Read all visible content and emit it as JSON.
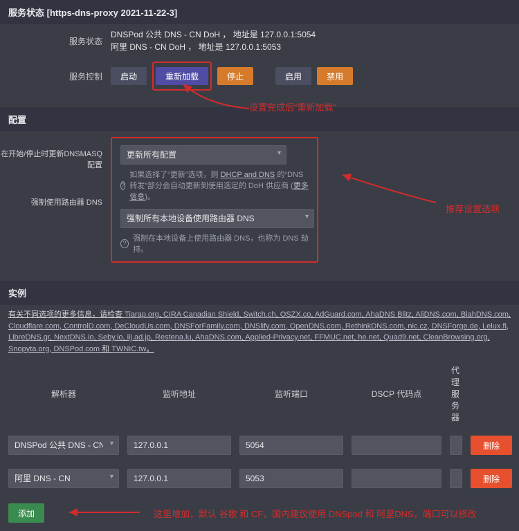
{
  "header": {
    "title": "服务状态 [https-dns-proxy 2021-11-22-3]"
  },
  "status": {
    "label": "服务状态",
    "line1": "DNSPod 公共 DNS - CN DoH ， 地址是 127.0.0.1:5054",
    "line2": "阿里 DNS - CN DoH ， 地址是 127.0.0.1:5053"
  },
  "control": {
    "label": "服务控制",
    "start": "启动",
    "reload": "重新加载",
    "stop": "停止",
    "enable": "启用",
    "disable": "禁用"
  },
  "anno": {
    "reload": "设置完成后“重新加载”",
    "recommend": "推荐设置选项",
    "footer": "这里增加，默认 谷歌 和 CF，国内建议使用 DNSpod 和 阿里DNS，端口可以修改"
  },
  "config": {
    "title": "配置",
    "dnsmasq": {
      "label": "在开始/停止时更新DNSMASQ配置",
      "value": "更新所有配置",
      "help_a": "如果选择了“更新”选项，则 ",
      "help_link": "DHCP and DNS",
      "help_b": " 的“DNS转发”部分会自动更新到使用选定的 DoH 供应商 (",
      "help_more": "更多信息",
      "help_c": ")。"
    },
    "forcedns": {
      "label": "强制使用路由器 DNS",
      "value": "强制所有本地设备使用路由器 DNS",
      "help": "强制在本地设备上使用路由器 DNS，也称为 DNS 劫持。"
    }
  },
  "instances": {
    "title": "实例",
    "info_prefix": "有关不同选项的更多信息，请检查 ",
    "suffix_a": " 和 ",
    "suffix_b": "。",
    "links": [
      "Tiarap.org",
      "CIRA Canadian Shield",
      "Switch.ch",
      "OSZX.co",
      "AdGuard.com",
      "AhaDNS Blitz",
      "AliDNS.com",
      "BlahDNS.com",
      "Cloudflare.com",
      "ControlD.com",
      "DeCloudUs.com",
      "DNSForFamily.com",
      "DNSlify.com",
      "OpenDNS.com",
      "RethinkDNS.com",
      "nic.cz",
      "DNSForge.de",
      "Lelux.fi",
      "LibreDNS.gr",
      "NextDNS.io",
      "Seby.io",
      "iij.ad.jp",
      "Restena.lu",
      "AhaDNS.com",
      "Applied-Privacy.net",
      "FFMUC.net",
      "he.net",
      "Quad9.net",
      "CleanBrowsing.org",
      "Snopyta.org",
      "DNSPod.com",
      "TWNIC.tw"
    ],
    "cols": {
      "resolver": "解析器",
      "addr": "监听地址",
      "port": "监听端口",
      "dscp": "DSCP 代码点",
      "proxy": "代理服务器"
    },
    "rows": [
      {
        "resolver": "DNSPod 公共 DNS - CN",
        "addr": "127.0.0.1",
        "port": "5054",
        "dscp": "",
        "proxy": ""
      },
      {
        "resolver": "阿里 DNS - CN",
        "addr": "127.0.0.1",
        "port": "5053",
        "dscp": "",
        "proxy": ""
      }
    ],
    "delete": "删除",
    "add": "添加"
  }
}
